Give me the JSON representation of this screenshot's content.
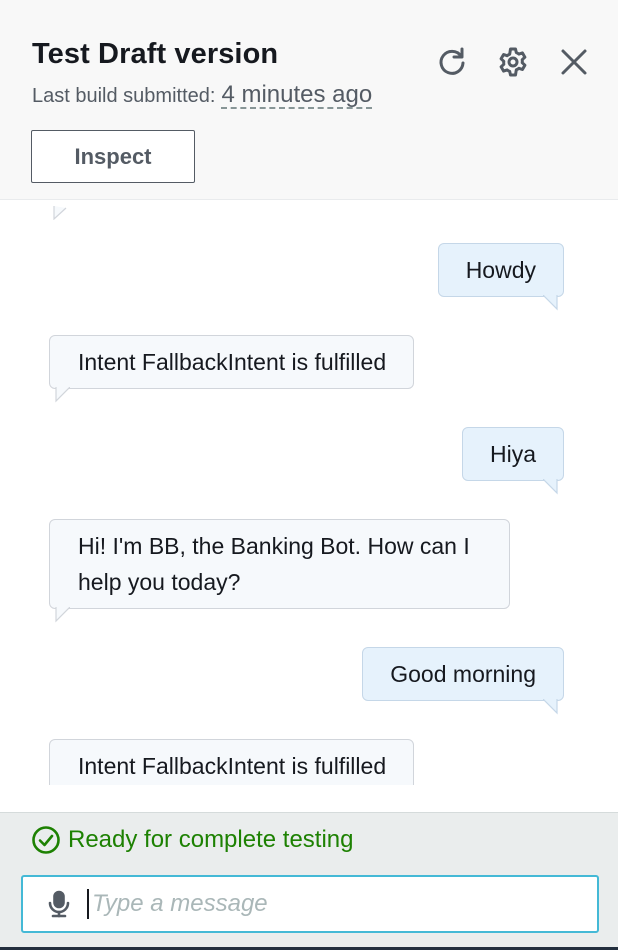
{
  "header": {
    "title": "Test Draft version",
    "subtitle_label": "Last build submitted:",
    "subtitle_time": "4 minutes ago",
    "inspect_label": "Inspect"
  },
  "icons": {
    "refresh": "refresh-icon",
    "settings": "gear-icon",
    "close": "close-icon",
    "mic": "microphone-icon",
    "status": "check-circle-icon"
  },
  "chat": {
    "messages": [
      {
        "sender": "user",
        "text": "Howdy"
      },
      {
        "sender": "bot",
        "text": "Intent FallbackIntent is fulfilled"
      },
      {
        "sender": "user",
        "text": "Hiya"
      },
      {
        "sender": "bot",
        "text": "Hi! I'm BB, the Banking Bot. How can I help you today?"
      },
      {
        "sender": "user",
        "text": "Good morning"
      },
      {
        "sender": "bot",
        "text": "Intent FallbackIntent is fulfilled"
      }
    ]
  },
  "footer": {
    "status_text": "Ready for complete testing",
    "input_placeholder": "Type a message",
    "input_value": ""
  },
  "colors": {
    "accent": "#ec7211",
    "status_green": "#1d8102",
    "focus_border": "#44b9d6",
    "user_bubble": "#e6f2fc",
    "bot_bubble": "#f6f9fc"
  }
}
